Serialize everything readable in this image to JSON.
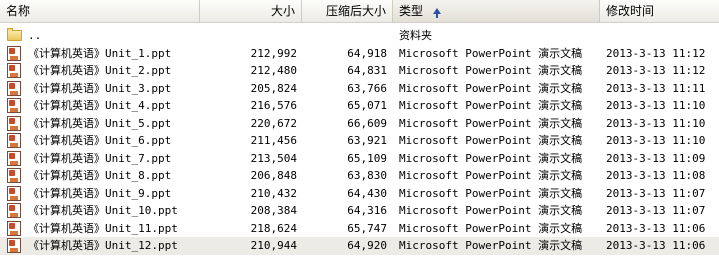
{
  "header": {
    "name": "名称",
    "size": "大小",
    "compressed_size": "压缩后大小",
    "type": "类型",
    "modified": "修改时间"
  },
  "rows": [
    {
      "icon": "folder-icon",
      "name": "..",
      "size": "",
      "csize": "",
      "type": "资料夹",
      "date": ""
    },
    {
      "icon": "powerpoint-file-icon",
      "name": "《计算机英语》Unit_1.ppt",
      "size": "212,992",
      "csize": "64,918",
      "type": "Microsoft PowerPoint 演示文稿",
      "date": "2013-3-13 11:12"
    },
    {
      "icon": "powerpoint-file-icon",
      "name": "《计算机英语》Unit_2.ppt",
      "size": "212,480",
      "csize": "64,831",
      "type": "Microsoft PowerPoint 演示文稿",
      "date": "2013-3-13 11:12"
    },
    {
      "icon": "powerpoint-file-icon",
      "name": "《计算机英语》Unit_3.ppt",
      "size": "205,824",
      "csize": "63,766",
      "type": "Microsoft PowerPoint 演示文稿",
      "date": "2013-3-13 11:11"
    },
    {
      "icon": "powerpoint-file-icon",
      "name": "《计算机英语》Unit_4.ppt",
      "size": "216,576",
      "csize": "65,071",
      "type": "Microsoft PowerPoint 演示文稿",
      "date": "2013-3-13 11:10"
    },
    {
      "icon": "powerpoint-file-icon",
      "name": "《计算机英语》Unit_5.ppt",
      "size": "220,672",
      "csize": "66,609",
      "type": "Microsoft PowerPoint 演示文稿",
      "date": "2013-3-13 11:10"
    },
    {
      "icon": "powerpoint-file-icon",
      "name": "《计算机英语》Unit_6.ppt",
      "size": "211,456",
      "csize": "63,921",
      "type": "Microsoft PowerPoint 演示文稿",
      "date": "2013-3-13 11:10"
    },
    {
      "icon": "powerpoint-file-icon",
      "name": "《计算机英语》Unit_7.ppt",
      "size": "213,504",
      "csize": "65,109",
      "type": "Microsoft PowerPoint 演示文稿",
      "date": "2013-3-13 11:09"
    },
    {
      "icon": "powerpoint-file-icon",
      "name": "《计算机英语》Unit_8.ppt",
      "size": "206,848",
      "csize": "63,830",
      "type": "Microsoft PowerPoint 演示文稿",
      "date": "2013-3-13 11:08"
    },
    {
      "icon": "powerpoint-file-icon",
      "name": "《计算机英语》Unit_9.ppt",
      "size": "210,432",
      "csize": "64,430",
      "type": "Microsoft PowerPoint 演示文稿",
      "date": "2013-3-13 11:07"
    },
    {
      "icon": "powerpoint-file-icon",
      "name": "《计算机英语》Unit_10.ppt",
      "size": "208,384",
      "csize": "64,316",
      "type": "Microsoft PowerPoint 演示文稿",
      "date": "2013-3-13 11:07"
    },
    {
      "icon": "powerpoint-file-icon",
      "name": "《计算机英语》Unit_11.ppt",
      "size": "218,624",
      "csize": "65,747",
      "type": "Microsoft PowerPoint 演示文稿",
      "date": "2013-3-13 11:06"
    },
    {
      "icon": "powerpoint-file-icon",
      "name": "《计算机英语》Unit_12.ppt",
      "size": "210,944",
      "csize": "64,920",
      "type": "Microsoft PowerPoint 演示文稿",
      "date": "2013-3-13 11:06",
      "selected": true
    }
  ]
}
